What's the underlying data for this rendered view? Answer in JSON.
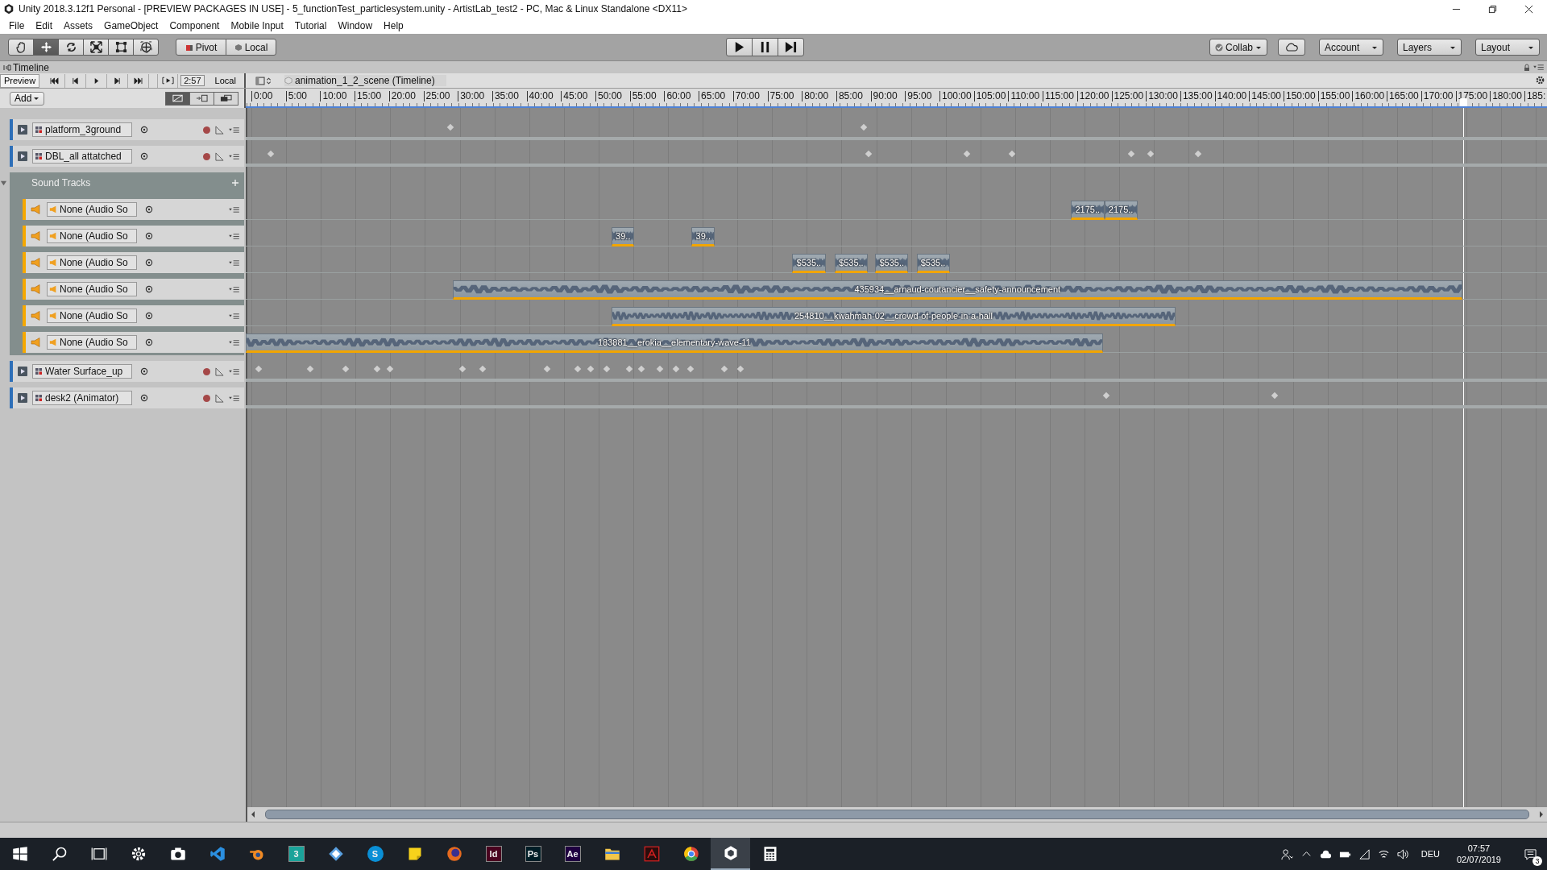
{
  "window": {
    "title": "Unity 2018.3.12f1 Personal - [PREVIEW PACKAGES IN USE] - 5_functionTest_particlesystem.unity - ArtistLab_test2 - PC, Mac & Linux Standalone <DX11>"
  },
  "menu": [
    "File",
    "Edit",
    "Assets",
    "GameObject",
    "Component",
    "Mobile Input",
    "Tutorial",
    "Window",
    "Help"
  ],
  "toolbar": {
    "tools": [
      {
        "kind": "hand",
        "selected": false
      },
      {
        "kind": "move",
        "selected": true
      },
      {
        "kind": "rotate",
        "selected": false
      },
      {
        "kind": "scale",
        "selected": false
      },
      {
        "kind": "rect",
        "selected": false
      },
      {
        "kind": "transform",
        "selected": false
      }
    ],
    "pivot": "Pivot",
    "space": "Local",
    "playback": [
      {
        "kind": "play",
        "selected": false
      },
      {
        "kind": "pause",
        "selected": false
      },
      {
        "kind": "step",
        "selected": false
      }
    ],
    "collab": "Collab",
    "account": "Account",
    "layers": "Layers",
    "layout": "Layout"
  },
  "timeline": {
    "tab": "Timeline",
    "preview": "Preview",
    "transport": [
      {
        "kind": "first"
      },
      {
        "kind": "prev"
      },
      {
        "kind": "play"
      },
      {
        "kind": "next"
      },
      {
        "kind": "last"
      }
    ],
    "time": "2:57",
    "space": "Local",
    "asset": "animation_1_2_scene (Timeline)",
    "add": "Add",
    "edit_modes": [
      {
        "kind": "mix",
        "selected": true
      },
      {
        "kind": "ripple",
        "selected": false
      },
      {
        "kind": "replace",
        "selected": false
      }
    ],
    "ruler": [
      "0:00",
      "5:00",
      "10:00",
      "15:00",
      "20:00",
      "25:00",
      "30:00",
      "35:00",
      "40:00",
      "45:00",
      "50:00",
      "55:00",
      "60:00",
      "65:00",
      "70:00",
      "75:00",
      "80:00",
      "85:00",
      "90:00",
      "95:00",
      "100:00",
      "105:00",
      "110:00",
      "115:00",
      "120:00",
      "125:00",
      "130:00",
      "135:00",
      "140:00",
      "145:00",
      "150:00",
      "155:00",
      "160:00",
      "165:00",
      "170:00",
      "175:00",
      "180:00",
      "185:"
    ],
    "tracks": [
      {
        "kind": "animation",
        "name": "platform_3ground"
      },
      {
        "kind": "animation",
        "name": "DBL_all attatched"
      },
      {
        "kind": "group",
        "name": "Sound Tracks",
        "expanded": true,
        "children": [
          {
            "kind": "audio",
            "name": "None (Audio So",
            "clips": [
              {
                "label": "2175.."
              },
              {
                "label": "2175.."
              }
            ]
          },
          {
            "kind": "audio",
            "name": "None (Audio So",
            "clips": [
              {
                "label": "39.."
              },
              {
                "label": "39.."
              }
            ]
          },
          {
            "kind": "audio",
            "name": "None (Audio So",
            "clips": [
              {
                "label": "$535.."
              },
              {
                "label": "$535.."
              },
              {
                "label": "$535.."
              },
              {
                "label": "$535.."
              }
            ]
          },
          {
            "kind": "audio",
            "name": "None (Audio So",
            "clips": [
              {
                "label": "435934__arnaud-coutancier__safety-announcement"
              }
            ]
          },
          {
            "kind": "audio",
            "name": "None (Audio So",
            "clips": [
              {
                "label": "254810__kwahmah-02__crowd-of-people-in-a-hall"
              }
            ]
          },
          {
            "kind": "audio",
            "name": "None (Audio So",
            "clips": [
              {
                "label": "183881__erokia__elementary-wave-11"
              }
            ]
          }
        ]
      },
      {
        "kind": "animation",
        "name": "Water Surface_up"
      },
      {
        "kind": "animation",
        "name": "desk2 (Animator)"
      }
    ]
  },
  "taskbar": {
    "apps": [
      {
        "kind": "start",
        "selected": false
      },
      {
        "kind": "search",
        "selected": false
      },
      {
        "kind": "taskview",
        "selected": false
      },
      {
        "kind": "settings",
        "selected": false
      },
      {
        "kind": "camera",
        "selected": false
      },
      {
        "kind": "vscode",
        "selected": false
      },
      {
        "kind": "blender",
        "selected": false
      },
      {
        "kind": "tile",
        "label": "3",
        "color": "#1aa39a",
        "selected": false
      },
      {
        "kind": "diamond",
        "selected": false
      },
      {
        "kind": "round",
        "label": "S",
        "color": "#0a8fd6",
        "selected": false
      },
      {
        "kind": "notes",
        "selected": false
      },
      {
        "kind": "firefox",
        "selected": false
      },
      {
        "kind": "tile",
        "label": "Id",
        "color": "#49021f",
        "selected": false
      },
      {
        "kind": "tile",
        "label": "Ps",
        "color": "#001d26",
        "selected": false
      },
      {
        "kind": "tile",
        "label": "Ae",
        "color": "#1f0040",
        "selected": false
      },
      {
        "kind": "folder",
        "selected": false
      },
      {
        "kind": "acrobat",
        "selected": false
      },
      {
        "kind": "chrome",
        "selected": false
      },
      {
        "kind": "unity",
        "selected": true
      },
      {
        "kind": "calculator",
        "selected": false
      }
    ],
    "language": "DEU",
    "time": "07:57",
    "date": "02/07/2019",
    "notifications": "3"
  }
}
